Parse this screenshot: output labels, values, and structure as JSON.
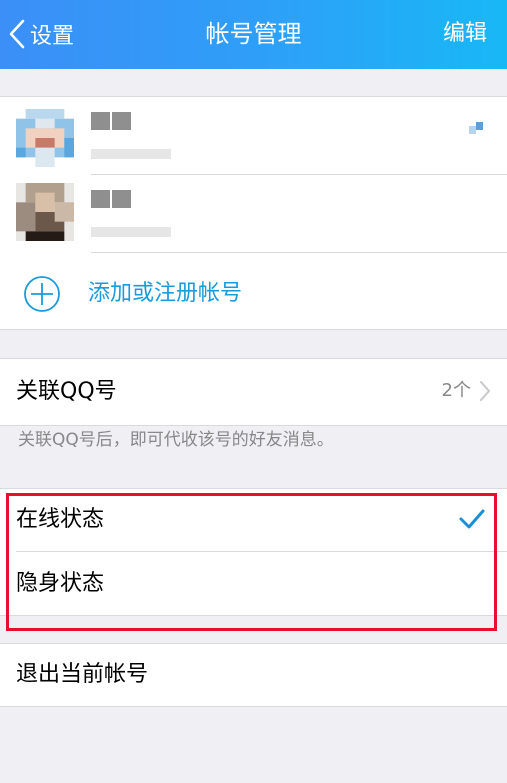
{
  "header": {
    "back_label": "设置",
    "title": "帐号管理",
    "edit_label": "编辑",
    "gradient": [
      "#3b8ff7",
      "#18b8f6"
    ]
  },
  "accounts": [
    {
      "name": "▪▪",
      "subtitle": "▪▪▪▪",
      "avatar": "pixelated-avatar-1",
      "is_current": true
    },
    {
      "name": "▪▪",
      "subtitle": "▪▪▪▪",
      "avatar": "pixelated-avatar-2",
      "is_current": false
    }
  ],
  "add_account": {
    "label": "添加或注册帐号",
    "icon": "plus-circle-icon",
    "color": "#1a9bdc"
  },
  "linked_qq": {
    "label": "关联QQ号",
    "count": "2个",
    "hint": "关联QQ号后，即可代收该号的好友消息。"
  },
  "status": [
    {
      "label": "在线状态",
      "selected": true
    },
    {
      "label": "隐身状态",
      "selected": false
    }
  ],
  "logout": {
    "label": "退出当前帐号"
  },
  "highlight_color": "#e60f2f"
}
